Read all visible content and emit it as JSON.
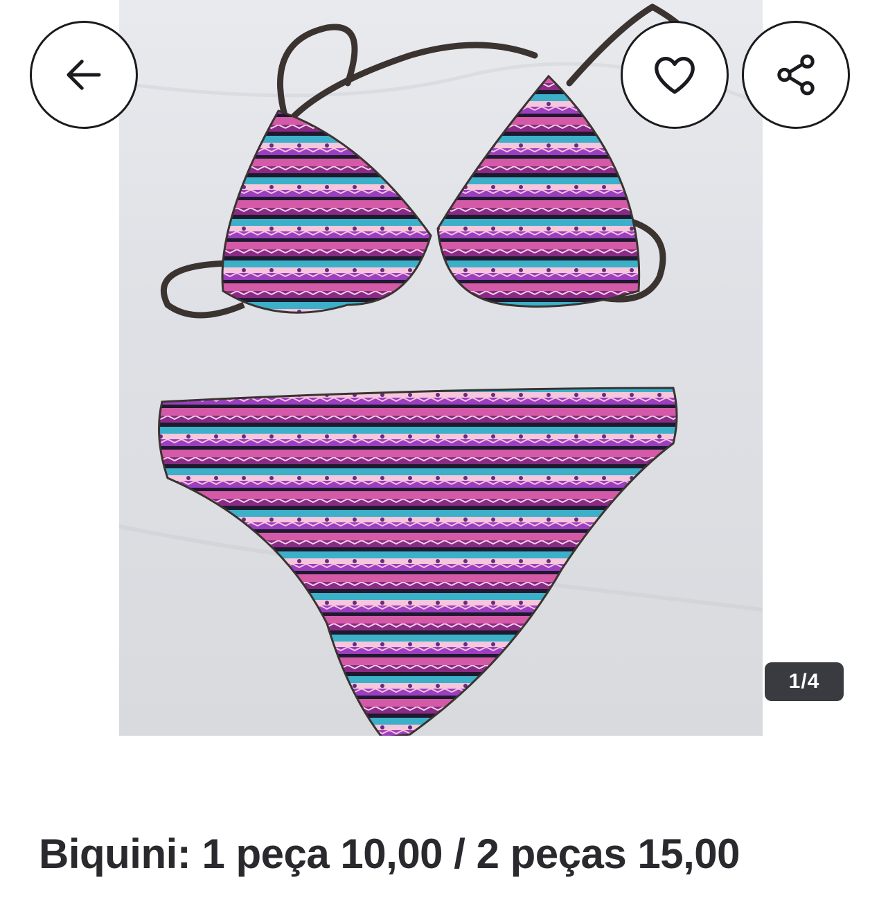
{
  "gallery": {
    "photo_alt": "Biquini",
    "counter": "1/4"
  },
  "icons": {
    "back": "arrow-left-icon",
    "favorite": "heart-outline-icon",
    "share": "share-icon"
  },
  "listing": {
    "title": "Biquini: 1 peça 10,00 / 2 peças 15,00"
  },
  "colors": {
    "button_border": "#1b1b1f",
    "counter_bg": "#3a3b40",
    "title_text": "#2a2a2e"
  }
}
